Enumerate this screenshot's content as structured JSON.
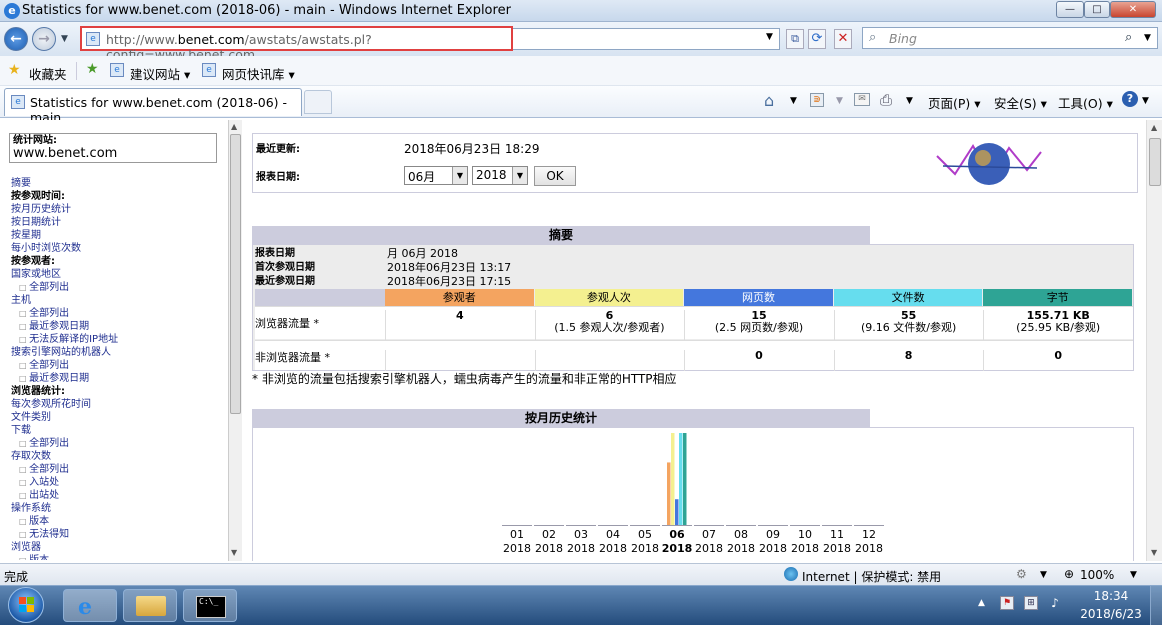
{
  "window": {
    "title": "Statistics for www.benet.com (2018-06) - main - Windows Internet Explorer",
    "min": "—",
    "max": "□",
    "close": "✕"
  },
  "nav": {
    "url_prefix": "http://www.",
    "url_domain": "benet.com",
    "url_suffix": "/awstats/awstats.pl?config=www.benet.com",
    "search_placeholder": "Bing"
  },
  "favorites": {
    "fav": "收藏夹",
    "suggest": "建议网站 ▾",
    "slices": "网页快讯库 ▾"
  },
  "tab": {
    "title": "Statistics for www.benet.com (2018-06) - main"
  },
  "tools": {
    "page": "页面(P) ▾",
    "safety": "安全(S) ▾",
    "tools": "工具(O) ▾",
    "help": "?"
  },
  "left": {
    "site_label": "统计网站:",
    "site": "www.benet.com",
    "menu": [
      {
        "t": "摘要",
        "k": "l"
      },
      {
        "t": "按参观时间:",
        "k": "s"
      },
      {
        "t": "按月历史统计",
        "k": "l"
      },
      {
        "t": "按日期统计",
        "k": "l"
      },
      {
        "t": "按星期",
        "k": "l"
      },
      {
        "t": "每小时浏览次数",
        "k": "l"
      },
      {
        "t": "按参观者:",
        "k": "s"
      },
      {
        "t": "国家或地区",
        "k": "l"
      },
      {
        "t": "全部列出",
        "k": "i"
      },
      {
        "t": "主机",
        "k": "l"
      },
      {
        "t": "全部列出",
        "k": "i"
      },
      {
        "t": "最近参观日期",
        "k": "i"
      },
      {
        "t": "无法反解译的IP地址",
        "k": "i"
      },
      {
        "t": "搜索引擎网站的机器人",
        "k": "l"
      },
      {
        "t": "全部列出",
        "k": "i"
      },
      {
        "t": "最近参观日期",
        "k": "i"
      },
      {
        "t": "浏览器统计:",
        "k": "s"
      },
      {
        "t": "每次参观所花时间",
        "k": "l"
      },
      {
        "t": "文件类别",
        "k": "l"
      },
      {
        "t": "下载",
        "k": "l"
      },
      {
        "t": "全部列出",
        "k": "i"
      },
      {
        "t": "存取次数",
        "k": "l"
      },
      {
        "t": "全部列出",
        "k": "i"
      },
      {
        "t": "入站处",
        "k": "i"
      },
      {
        "t": "出站处",
        "k": "i"
      },
      {
        "t": "操作系统",
        "k": "l"
      },
      {
        "t": "版本",
        "k": "i"
      },
      {
        "t": "无法得知",
        "k": "i"
      },
      {
        "t": "浏览器",
        "k": "l"
      },
      {
        "t": "版本",
        "k": "i"
      }
    ]
  },
  "main": {
    "last_update_label": "最近更新:",
    "last_update": "2018年06月23日 18:29",
    "report_date_label": "报表日期:",
    "month": "06月",
    "year": "2018",
    "ok": "OK",
    "summary": {
      "title": "摘要",
      "rows": [
        {
          "label": "报表日期",
          "value": "月 06月 2018"
        },
        {
          "label": "首次参观日期",
          "value": "2018年06月23日 13:17"
        },
        {
          "label": "最近参观日期",
          "value": "2018年06月23日 17:15"
        }
      ],
      "columns": [
        {
          "name": "参观者",
          "color": "#f4a460"
        },
        {
          "name": "参观人次",
          "color": "#f4f090"
        },
        {
          "name": "网页数",
          "color": "#4477dd"
        },
        {
          "name": "文件数",
          "color": "#66ddee"
        },
        {
          "name": "字节",
          "color": "#2ea495"
        }
      ],
      "viewed_label": "浏览器流量 *",
      "viewed": [
        {
          "v": "4",
          "s": ""
        },
        {
          "v": "6",
          "s": "(1.5 参观人次/参观者)"
        },
        {
          "v": "15",
          "s": "(2.5 网页数/参观)"
        },
        {
          "v": "55",
          "s": "(9.16 文件数/参观)"
        },
        {
          "v": "155.71 KB",
          "s": "(25.95 KB/参观)"
        }
      ],
      "notviewed_label": "非浏览器流量 *",
      "notviewed": [
        "",
        "",
        "0",
        "8",
        "0"
      ],
      "note": "* 非浏览的流量包括搜索引擎机器人，蠕虫病毒产生的流量和非正常的HTTP相应"
    },
    "monthly_title": "按月历史统计"
  },
  "chart_data": {
    "type": "bar",
    "categories": [
      "01 2018",
      "02 2018",
      "03 2018",
      "04 2018",
      "05 2018",
      "06 2018",
      "07 2018",
      "08 2018",
      "09 2018",
      "10 2018",
      "11 2018",
      "12 2018"
    ],
    "months": [
      "01",
      "02",
      "03",
      "04",
      "05",
      "06",
      "07",
      "08",
      "09",
      "10",
      "11",
      "12"
    ],
    "years": [
      "2018",
      "2018",
      "2018",
      "2018",
      "2018",
      "2018",
      "2018",
      "2018",
      "2018",
      "2018",
      "2018",
      "2018"
    ],
    "series": [
      {
        "name": "参观者",
        "color": "#f4a460",
        "values": [
          0,
          0,
          0,
          0,
          0,
          4,
          0,
          0,
          0,
          0,
          0,
          0
        ]
      },
      {
        "name": "参观人次",
        "color": "#f4f090",
        "values": [
          0,
          0,
          0,
          0,
          0,
          6,
          0,
          0,
          0,
          0,
          0,
          0
        ]
      },
      {
        "name": "网页数",
        "color": "#4477dd",
        "values": [
          0,
          0,
          0,
          0,
          0,
          15,
          0,
          0,
          0,
          0,
          0,
          0
        ]
      },
      {
        "name": "文件数",
        "color": "#66ddee",
        "values": [
          0,
          0,
          0,
          0,
          0,
          55,
          0,
          0,
          0,
          0,
          0,
          0
        ]
      },
      {
        "name": "字节",
        "color": "#2ea495",
        "values": [
          0,
          0,
          0,
          0,
          0,
          155.71,
          0,
          0,
          0,
          0,
          0,
          0
        ]
      }
    ],
    "highlight_index": 5
  },
  "status": {
    "left": "完成",
    "zone": "Internet | 保护模式: 禁用",
    "zoom": "100%"
  },
  "taskbar": {
    "time": "18:34",
    "date": "2018/6/23"
  }
}
